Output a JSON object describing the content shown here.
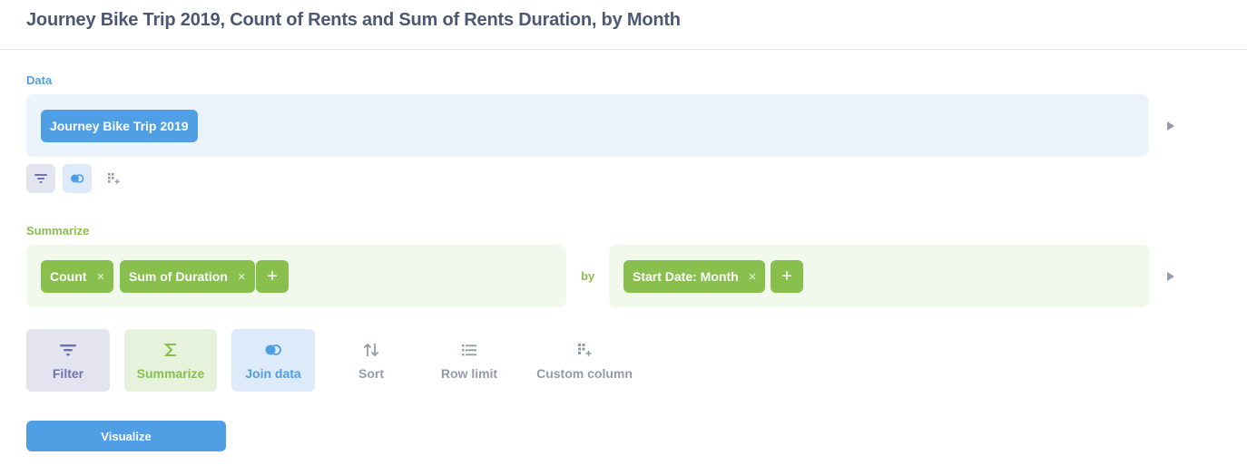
{
  "header": {
    "title": "Journey Bike Trip 2019, Count of Rents and Sum of Rents Duration, by Month"
  },
  "data_step": {
    "label": "Data",
    "table": "Journey Bike Trip 2019",
    "mini_actions": [
      "filter-icon",
      "join-icon",
      "custom-column-icon"
    ]
  },
  "summarize_step": {
    "label": "Summarize",
    "metrics": [
      "Count",
      "Sum of Duration"
    ],
    "by_label": "by",
    "breakouts": [
      "Start Date: Month"
    ],
    "remove_glyph": "×",
    "add_glyph": "+"
  },
  "actions": [
    {
      "label": "Filter",
      "icon": "filter-icon"
    },
    {
      "label": "Summarize",
      "icon": "sigma-icon"
    },
    {
      "label": "Join data",
      "icon": "join-icon"
    },
    {
      "label": "Sort",
      "icon": "sort-icon"
    },
    {
      "label": "Row limit",
      "icon": "list-icon"
    },
    {
      "label": "Custom column",
      "icon": "custom-column-icon"
    }
  ],
  "visualize_label": "Visualize",
  "colors": {
    "brand": "#509ee3",
    "summarize": "#88bf4d",
    "filter": "#7172ad",
    "text": "#4c5773",
    "muted": "#949aab"
  }
}
